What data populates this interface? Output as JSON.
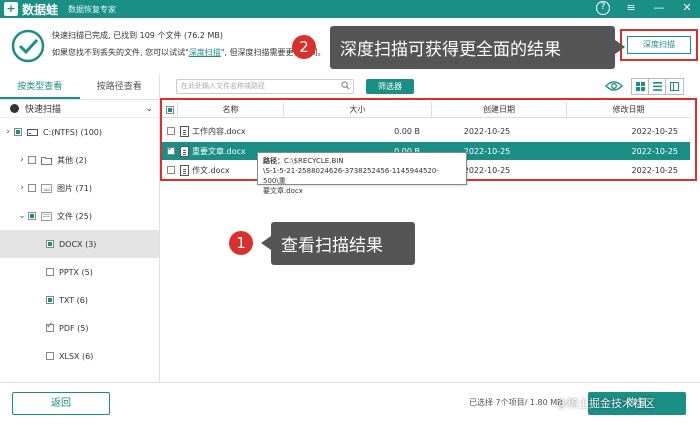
{
  "titlebar": {
    "logo_mark": "+",
    "app_name": "数据蛙",
    "subtitle": "数据恢复专家",
    "help_icon": "help-circle-icon",
    "menu_icon": "menu-icon",
    "minimize_icon": "minimize-icon",
    "close_icon": "close-icon"
  },
  "status": {
    "line1": "快速扫描已完成, 已找到 109 个文件 (76.2 MB)",
    "line2_prefix": "如果您找不到丢失的文件, 您可以试试\"",
    "line2_link": "深度扫描",
    "line2_suffix": "\", 但深度扫描需要更长时间。",
    "deep_scan_button": "深度扫描"
  },
  "callouts": {
    "top": {
      "number": "2",
      "text": "深度扫描可获得更全面的结果"
    },
    "middle": {
      "number": "1",
      "text": "查看扫描结果"
    }
  },
  "left": {
    "tabs": [
      "按类型查看",
      "按路径查看"
    ],
    "quick_scan": "快速扫描",
    "tree": [
      {
        "label": "C:(NTFS) (100)",
        "caret": "›",
        "check": "partial",
        "icon": "drive-icon"
      },
      {
        "label": "其他 (2)",
        "caret": "›",
        "check": "none",
        "icon": "folder-icon"
      },
      {
        "label": "图片 (71)",
        "caret": "›",
        "check": "none",
        "icon": "image-icon"
      },
      {
        "label": "文件 (25)",
        "caret": "⌄",
        "check": "partial",
        "icon": "document-icon"
      },
      {
        "label": "DOCX (3)",
        "caret": "",
        "check": "partial",
        "icon": ""
      },
      {
        "label": "PPTX (5)",
        "caret": "",
        "check": "none",
        "icon": ""
      },
      {
        "label": "TXT (6)",
        "caret": "",
        "check": "partial",
        "icon": ""
      },
      {
        "label": "PDF (5)",
        "caret": "",
        "check": "checked",
        "icon": ""
      },
      {
        "label": "XLSX (6)",
        "caret": "",
        "check": "none",
        "icon": ""
      }
    ]
  },
  "toolbar": {
    "search_placeholder": "在此处输入文件名称或路径",
    "filter_button": "筛选器"
  },
  "table": {
    "headers": [
      "名称",
      "大小",
      "创建日期",
      "修改日期"
    ],
    "rows": [
      {
        "name": "工作内容.docx",
        "size": "0.00  B",
        "created": "2022-10-25",
        "modified": "2022-10-25",
        "selected": false
      },
      {
        "name": "重要文章.docx",
        "size": "0.00  B",
        "created": "2022-10-25",
        "modified": "2022-10-25",
        "selected": true
      },
      {
        "name": "作文.docx",
        "size": "",
        "created": "2022-10-25",
        "modified": "2022-10-25",
        "selected": false
      }
    ]
  },
  "tooltip": {
    "label": "路径：",
    "line1": "C:\\$RECYCLE.BIN",
    "line2": "\\S-1-5-21-2588024626-3738252456-1145944520-500\\重",
    "line3": "要文章.docx"
  },
  "bottom": {
    "back_button": "返回",
    "selection_text": "已选择 7个项目/ 1.80 MB",
    "recover_button": "恢复",
    "watermark": "@稀土掘金技术社区"
  },
  "colors": {
    "accent": "#1a8f86",
    "highlight": "#d9302c",
    "callout": "#555555"
  }
}
